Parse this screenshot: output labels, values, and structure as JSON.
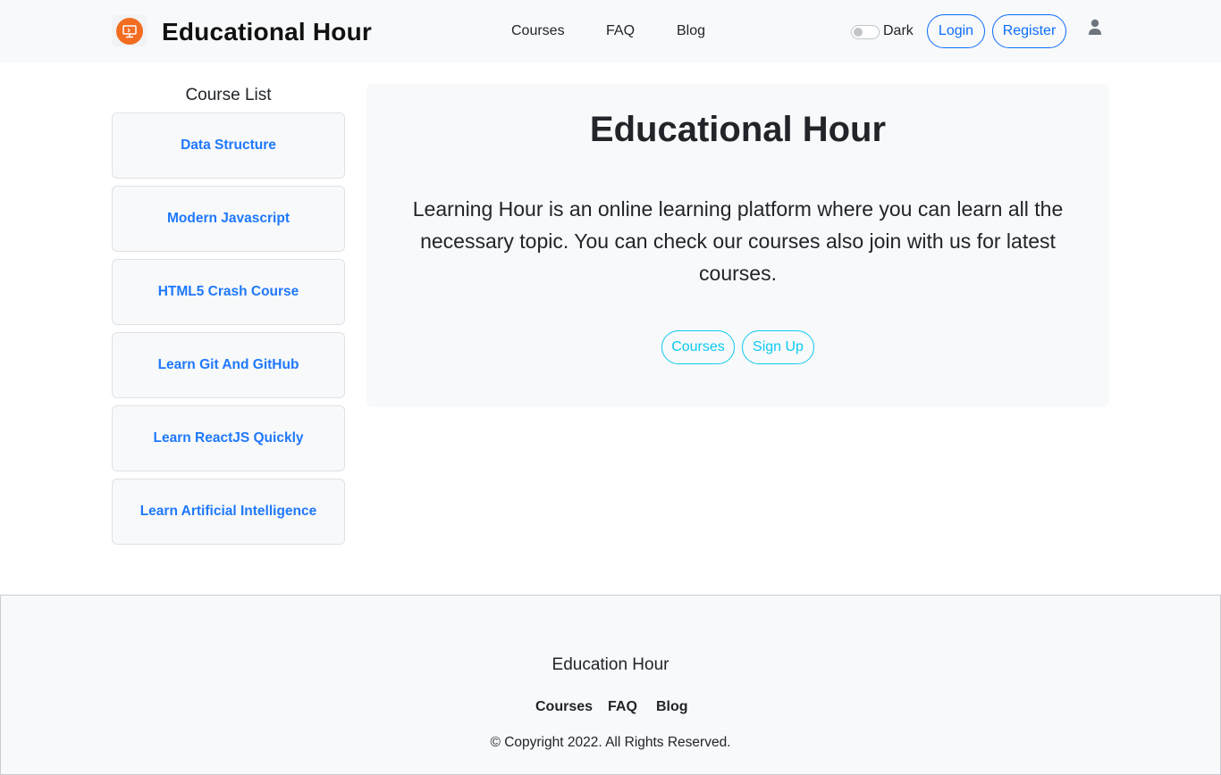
{
  "navbar": {
    "brand": "Educational Hour",
    "logo_icon": "monitor-icon",
    "links": [
      "Courses",
      "FAQ",
      "Blog"
    ],
    "theme_toggle_label": "Dark",
    "login_label": "Login",
    "register_label": "Register",
    "user_icon": "user-icon"
  },
  "sidebar": {
    "title": "Course List",
    "courses": [
      "Data Structure",
      "Modern Javascript",
      "HTML5 Crash Course",
      "Learn Git And GitHub",
      "Learn ReactJS Quickly",
      "Learn Artificial Intelligence"
    ]
  },
  "hero": {
    "title": "Educational Hour",
    "description": "Learning Hour is an online learning platform where you can learn all the necessary topic. You can check our courses also join with us for latest courses.",
    "courses_button": "Courses",
    "signup_button": "Sign Up"
  },
  "footer": {
    "title": "Education Hour",
    "links": [
      "Courses",
      "FAQ",
      "Blog"
    ],
    "copyright": "© Copyright 2022. All Rights Reserved."
  },
  "colors": {
    "primary": "#0d6efd",
    "info": "#0dcaf0",
    "logo_orange": "#f26c21",
    "light_bg": "#f8f9fa"
  }
}
